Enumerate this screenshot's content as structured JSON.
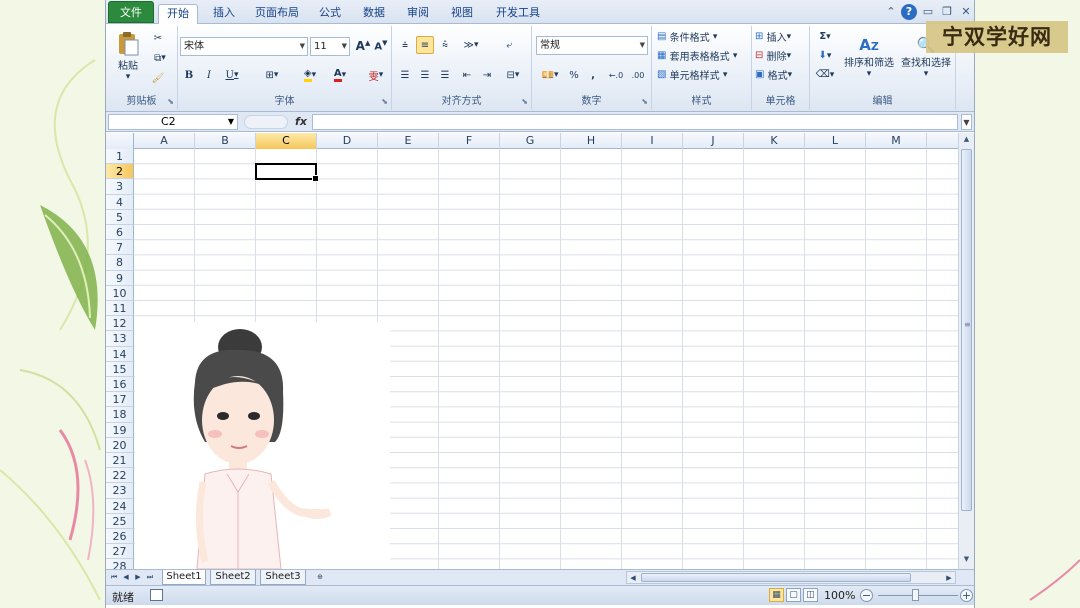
{
  "tabs": [
    "文件",
    "开始",
    "插入",
    "页面布局",
    "公式",
    "数据",
    "审阅",
    "视图",
    "开发工具"
  ],
  "active_tab": "开始",
  "ribbon": {
    "clipboard": {
      "label": "剪贴板",
      "paste": "粘贴"
    },
    "font": {
      "label": "字体",
      "name": "宋体",
      "size": "11",
      "bold": "B",
      "italic": "I",
      "underline": "U",
      "wen": "雯"
    },
    "alignment": {
      "label": "对齐方式"
    },
    "number": {
      "label": "数字",
      "format": "常规",
      "percent": "%",
      "comma": ","
    },
    "styles": {
      "label": "样式",
      "conditional": "条件格式",
      "table": "套用表格格式",
      "cell": "单元格样式"
    },
    "cells": {
      "label": "单元格",
      "insert": "插入",
      "delete": "删除",
      "format": "格式"
    },
    "editing": {
      "label": "编辑",
      "sort": "排序和筛选",
      "find": "查找和选择",
      "sigma": "Σ"
    }
  },
  "formula_bar": {
    "name_box": "C2",
    "fx": "fx",
    "content": ""
  },
  "columns": [
    "A",
    "B",
    "C",
    "D",
    "E",
    "F",
    "G",
    "H",
    "I",
    "J",
    "K",
    "L",
    "M"
  ],
  "rows": [
    "1",
    "2",
    "3",
    "4",
    "5",
    "6",
    "7",
    "8",
    "9",
    "10",
    "11",
    "12",
    "13",
    "14",
    "15",
    "16",
    "17",
    "18",
    "19",
    "20",
    "21",
    "22",
    "23",
    "24",
    "25",
    "26",
    "27",
    "28"
  ],
  "active_cell": "C2",
  "sheets": [
    "Sheet1",
    "Sheet2",
    "Sheet3"
  ],
  "active_sheet": "Sheet1",
  "status": {
    "ready": "就绪",
    "zoom": "100%"
  },
  "watermark": "宁双学好网",
  "colors": {
    "file_tab": "#2c8a3c",
    "selection_header": "#f6c75c",
    "ribbon_bg": "#e7eef7"
  }
}
